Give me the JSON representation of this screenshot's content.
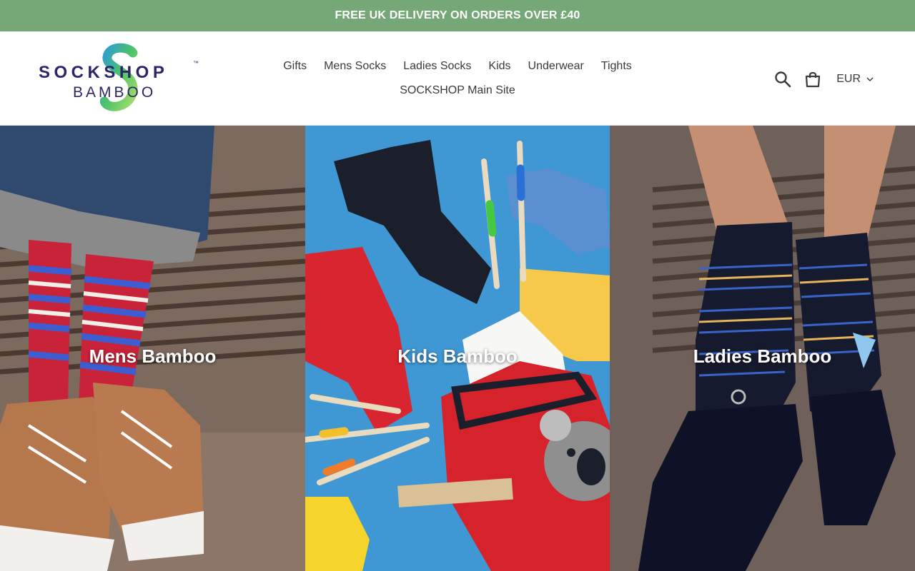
{
  "announcement": {
    "text": "FREE UK DELIVERY ON ORDERS OVER £40"
  },
  "logo": {
    "word": "SOCKSHOP",
    "sub": "BAMBOO",
    "tm": "™"
  },
  "nav": {
    "items": [
      "Gifts",
      "Mens Socks",
      "Ladies Socks",
      "Kids",
      "Underwear",
      "Tights",
      "SOCKSHOP Main Site"
    ]
  },
  "tools": {
    "search_icon": "search-icon",
    "cart_icon": "cart-icon",
    "currency": "EUR"
  },
  "collections": [
    {
      "label": "Mens Bamboo"
    },
    {
      "label": "Kids Bamboo"
    },
    {
      "label": "Ladies Bamboo"
    }
  ],
  "colors": {
    "announcement_bg": "#76a877",
    "brand_navy": "#2b2668",
    "brand_green": "#4cc26a",
    "kids_bg": "#3f98d4"
  }
}
